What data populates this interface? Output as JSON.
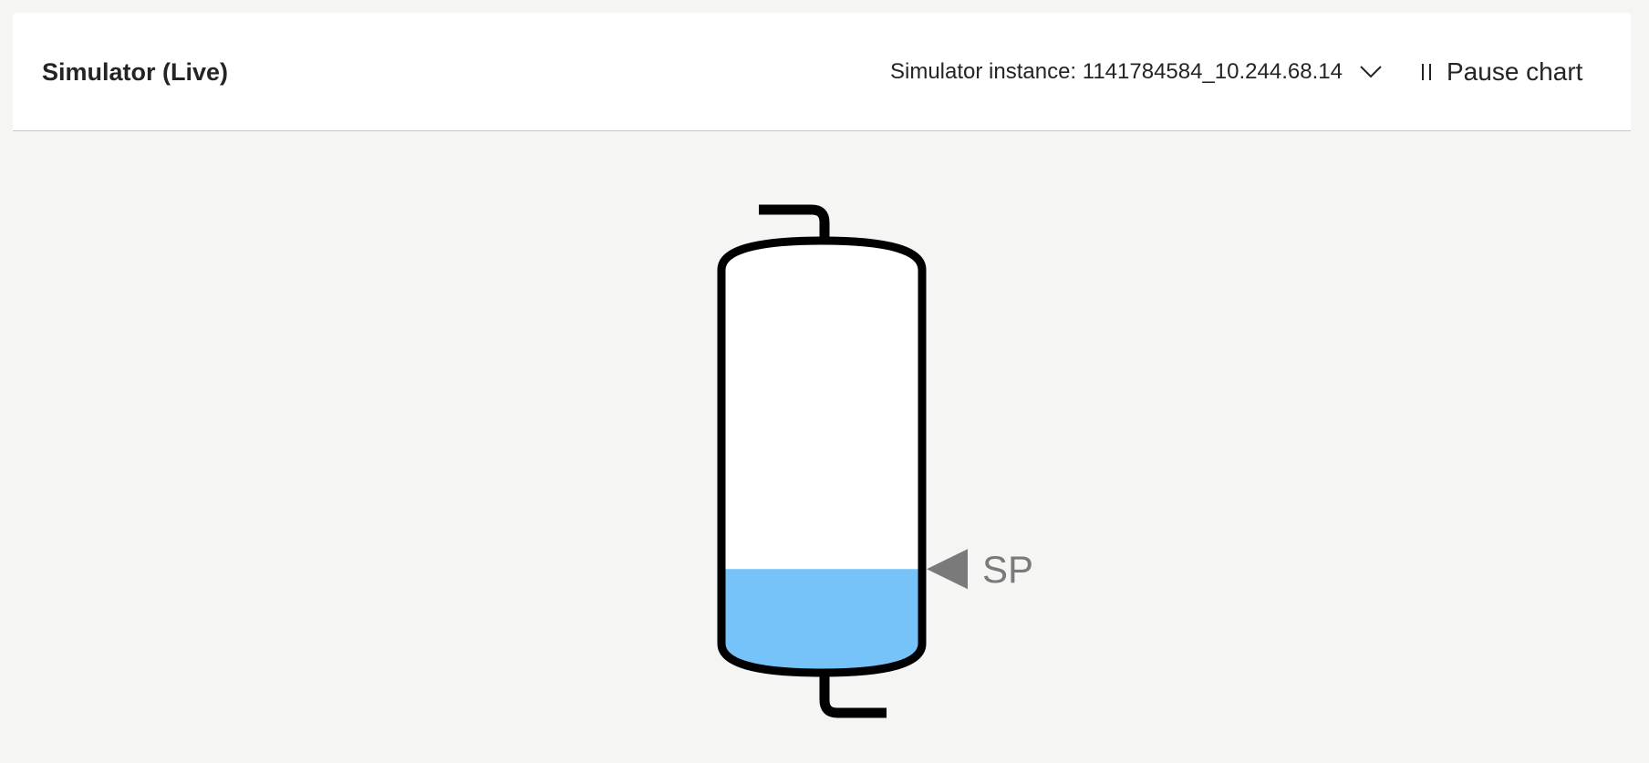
{
  "header": {
    "title": "Simulator (Live)",
    "instance_selector": {
      "label_prefix": "Simulator instance: ",
      "selected_value": "1141784584_10.244.68.14",
      "icon": "chevron-down-icon"
    },
    "pause_button": {
      "label": "Pause chart",
      "icon": "pause-icon"
    }
  },
  "tank": {
    "fill_level_fraction": 0.24,
    "setpoint_fraction": 0.24,
    "setpoint_label": "SP",
    "colors": {
      "liquid": "#75c3f8",
      "outline": "#000000",
      "marker": "#7a7a7a"
    }
  }
}
